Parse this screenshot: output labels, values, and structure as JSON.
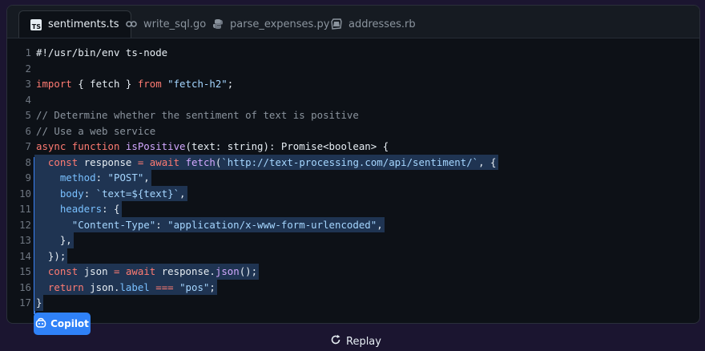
{
  "tabs": [
    {
      "label": "sentiments.ts",
      "icon": "typescript-icon",
      "active": true
    },
    {
      "label": "write_sql.go",
      "icon": "go-icon",
      "active": false
    },
    {
      "label": "parse_expenses.py",
      "icon": "python-icon",
      "active": false
    },
    {
      "label": "addresses.rb",
      "icon": "ruby-icon",
      "active": false
    }
  ],
  "code_lines": [
    {
      "n": "1",
      "tokens": [
        [
          "plain",
          "#!/usr/bin/env ts-node"
        ]
      ]
    },
    {
      "n": "2",
      "tokens": []
    },
    {
      "n": "3",
      "tokens": [
        [
          "kw",
          "import"
        ],
        [
          "plain",
          " { fetch } "
        ],
        [
          "kw",
          "from"
        ],
        [
          "plain",
          " "
        ],
        [
          "str",
          "\"fetch-h2\""
        ],
        [
          "plain",
          ";"
        ]
      ]
    },
    {
      "n": "4",
      "tokens": []
    },
    {
      "n": "5",
      "tokens": [
        [
          "com",
          "// Determine whether the sentiment of text is positive"
        ]
      ]
    },
    {
      "n": "6",
      "tokens": [
        [
          "com",
          "// Use a web service"
        ]
      ]
    },
    {
      "n": "7",
      "tokens": [
        [
          "kw",
          "async function"
        ],
        [
          "plain",
          " "
        ],
        [
          "fn",
          "isPositive"
        ],
        [
          "plain",
          "(text: string): Promise<boolean> {"
        ]
      ]
    },
    {
      "n": "8",
      "tokens": [
        [
          "plain",
          "  "
        ],
        [
          "kw",
          "const"
        ],
        [
          "plain",
          " response "
        ],
        [
          "kw",
          "="
        ],
        [
          "plain",
          " "
        ],
        [
          "kw",
          "await"
        ],
        [
          "plain",
          " "
        ],
        [
          "fn",
          "fetch"
        ],
        [
          "plain",
          "("
        ],
        [
          "str",
          "`http://text-processing.com/api/sentiment/`"
        ],
        [
          "plain",
          ", {"
        ]
      ]
    },
    {
      "n": "9",
      "tokens": [
        [
          "plain",
          "    "
        ],
        [
          "prop",
          "method"
        ],
        [
          "plain",
          ": "
        ],
        [
          "str",
          "\"POST\""
        ],
        [
          "plain",
          ","
        ]
      ]
    },
    {
      "n": "10",
      "tokens": [
        [
          "plain",
          "    "
        ],
        [
          "prop",
          "body"
        ],
        [
          "plain",
          ": "
        ],
        [
          "str",
          "`text=${text}`"
        ],
        [
          "plain",
          ","
        ]
      ]
    },
    {
      "n": "11",
      "tokens": [
        [
          "plain",
          "    "
        ],
        [
          "prop",
          "headers"
        ],
        [
          "plain",
          ": {"
        ]
      ]
    },
    {
      "n": "12",
      "tokens": [
        [
          "plain",
          "      "
        ],
        [
          "str",
          "\"Content-Type\""
        ],
        [
          "plain",
          ": "
        ],
        [
          "str",
          "\"application/x-www-form-urlencoded\""
        ],
        [
          "plain",
          ","
        ]
      ]
    },
    {
      "n": "13",
      "tokens": [
        [
          "plain",
          "    },"
        ]
      ]
    },
    {
      "n": "14",
      "tokens": [
        [
          "plain",
          "  });"
        ]
      ]
    },
    {
      "n": "15",
      "tokens": [
        [
          "plain",
          "  "
        ],
        [
          "kw",
          "const"
        ],
        [
          "plain",
          " json "
        ],
        [
          "kw",
          "="
        ],
        [
          "plain",
          " "
        ],
        [
          "kw",
          "await"
        ],
        [
          "plain",
          " response."
        ],
        [
          "fn",
          "json"
        ],
        [
          "plain",
          "();"
        ]
      ]
    },
    {
      "n": "16",
      "tokens": [
        [
          "plain",
          "  "
        ],
        [
          "kw",
          "return"
        ],
        [
          "plain",
          " json."
        ],
        [
          "prop",
          "label"
        ],
        [
          "plain",
          " "
        ],
        [
          "kw",
          "==="
        ],
        [
          "plain",
          " "
        ],
        [
          "str",
          "\"pos\""
        ],
        [
          "plain",
          ";"
        ]
      ]
    },
    {
      "n": "17",
      "tokens": [
        [
          "plain",
          "}"
        ]
      ]
    }
  ],
  "selection": {
    "from_line": 8,
    "to_line": 17
  },
  "copilot_label": "Copilot",
  "replay_label": "Replay",
  "colors": {
    "accent": "#2f81f7",
    "keyword": "#ff7b72",
    "string": "#a5d6ff",
    "function": "#d2a8ff",
    "comment": "#8b949e"
  }
}
